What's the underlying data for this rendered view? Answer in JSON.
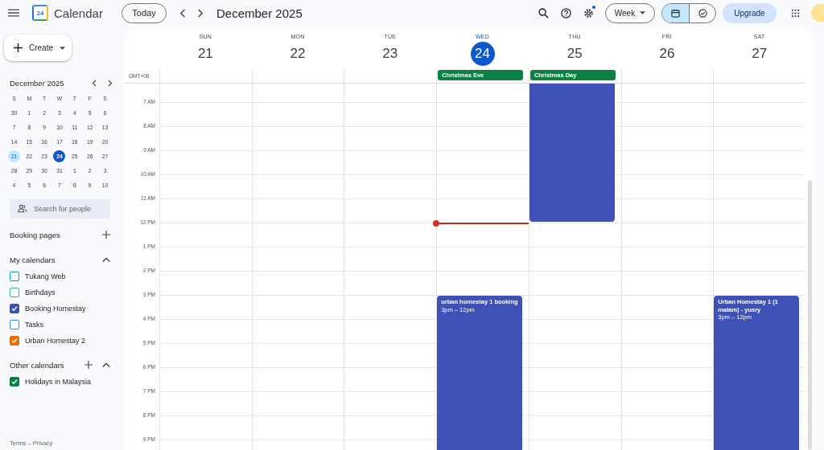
{
  "app": {
    "title": "Calendar",
    "logo_text": "24"
  },
  "toolbar": {
    "today": "Today",
    "period": "December 2025",
    "view": "Week",
    "modes": [
      {
        "kind": "calendar",
        "selected": true
      },
      {
        "kind": "tasks",
        "selected": false
      }
    ],
    "upgrade": "Upgrade",
    "settings_badge": true
  },
  "sidebar": {
    "create": "Create",
    "mini_calendar": {
      "title": "December 2025",
      "weekdays": [
        "S",
        "M",
        "T",
        "W",
        "T",
        "F",
        "S"
      ],
      "weeks": [
        [
          {
            "d": "30",
            "selected": false,
            "today": false
          },
          {
            "d": "1",
            "selected": false,
            "today": false
          },
          {
            "d": "2",
            "selected": false,
            "today": false
          },
          {
            "d": "3",
            "selected": false,
            "today": false
          },
          {
            "d": "4",
            "selected": false,
            "today": false
          },
          {
            "d": "5",
            "selected": false,
            "today": false
          },
          {
            "d": "6",
            "selected": false,
            "today": false
          }
        ],
        [
          {
            "d": "7",
            "selected": false,
            "today": false
          },
          {
            "d": "8",
            "selected": false,
            "today": false
          },
          {
            "d": "9",
            "selected": false,
            "today": false
          },
          {
            "d": "10",
            "selected": false,
            "today": false
          },
          {
            "d": "11",
            "selected": false,
            "today": false
          },
          {
            "d": "12",
            "selected": false,
            "today": false
          },
          {
            "d": "13",
            "selected": false,
            "today": false
          }
        ],
        [
          {
            "d": "14",
            "selected": false,
            "today": false
          },
          {
            "d": "15",
            "selected": false,
            "today": false
          },
          {
            "d": "16",
            "selected": false,
            "today": false
          },
          {
            "d": "17",
            "selected": false,
            "today": false
          },
          {
            "d": "18",
            "selected": false,
            "today": false
          },
          {
            "d": "19",
            "selected": false,
            "today": false
          },
          {
            "d": "20",
            "selected": false,
            "today": false
          }
        ],
        [
          {
            "d": "21",
            "selected": true,
            "today": false
          },
          {
            "d": "22",
            "selected": false,
            "today": false
          },
          {
            "d": "23",
            "selected": false,
            "today": false
          },
          {
            "d": "24",
            "selected": false,
            "today": true
          },
          {
            "d": "25",
            "selected": false,
            "today": false
          },
          {
            "d": "26",
            "selected": false,
            "today": false
          },
          {
            "d": "27",
            "selected": false,
            "today": false
          }
        ],
        [
          {
            "d": "28",
            "selected": false,
            "today": false
          },
          {
            "d": "29",
            "selected": false,
            "today": false
          },
          {
            "d": "30",
            "selected": false,
            "today": false
          },
          {
            "d": "31",
            "selected": false,
            "today": false
          },
          {
            "d": "1",
            "selected": false,
            "today": false
          },
          {
            "d": "2",
            "selected": false,
            "today": false
          },
          {
            "d": "3",
            "selected": false,
            "today": false
          }
        ],
        [
          {
            "d": "4",
            "selected": false,
            "today": false
          },
          {
            "d": "5",
            "selected": false,
            "today": false
          },
          {
            "d": "6",
            "selected": false,
            "today": false
          },
          {
            "d": "7",
            "selected": false,
            "today": false
          },
          {
            "d": "8",
            "selected": false,
            "today": false
          },
          {
            "d": "9",
            "selected": false,
            "today": false
          },
          {
            "d": "10",
            "selected": false,
            "today": false
          }
        ]
      ]
    },
    "search": {
      "placeholder": "Search for people"
    },
    "booking_pages": "Booking pages",
    "my_calendars": {
      "title": "My calendars",
      "expanded": true,
      "items": [
        {
          "name": "Tukang Web",
          "checked": false,
          "color": "#039be5"
        },
        {
          "name": "Birthdays",
          "checked": false,
          "color": "#33b679"
        },
        {
          "name": "Booking Homestay",
          "checked": true,
          "color": "#3f51b5"
        },
        {
          "name": "Tasks",
          "checked": false,
          "color": "#4285f4"
        },
        {
          "name": "Urban Homestay 2",
          "checked": true,
          "color": "#ef6c00"
        }
      ]
    },
    "other_calendars": {
      "title": "Other calendars",
      "expanded": true,
      "items": [
        {
          "name": "Holidays in Malaysia",
          "checked": true,
          "color": "#0b8043"
        }
      ]
    },
    "footer": "Terms – Privacy"
  },
  "week": {
    "timezone": "GMT+08",
    "days": [
      {
        "name": "SUN",
        "date": "21",
        "today": false
      },
      {
        "name": "MON",
        "date": "22",
        "today": false
      },
      {
        "name": "TUE",
        "date": "23",
        "today": false
      },
      {
        "name": "WED",
        "date": "24",
        "today": true,
        "all_day": [
          {
            "title": "Christmas Eve"
          }
        ],
        "event": {
          "title": "urban homestay 1 booking",
          "time": "3pm – 12pm"
        },
        "busy": [
          false,
          false,
          false,
          false,
          false,
          false,
          false,
          false,
          false,
          true,
          true,
          true,
          true,
          true,
          true,
          true
        ]
      },
      {
        "name": "THU",
        "date": "25",
        "today": false,
        "all_day": [
          {
            "title": "Christmas Day"
          }
        ],
        "busy": [
          true,
          true,
          true,
          true,
          true,
          true,
          false,
          false,
          false,
          false,
          false,
          false,
          false,
          false,
          false,
          false
        ]
      },
      {
        "name": "FRI",
        "date": "26",
        "today": false
      },
      {
        "name": "SAT",
        "date": "27",
        "today": false,
        "event": {
          "title": "Urban Homestay 1 (1 malam) - yusry",
          "time": "3pm – 12pm"
        },
        "busy": [
          false,
          false,
          false,
          false,
          false,
          false,
          false,
          false,
          false,
          true,
          true,
          true,
          true,
          true,
          true,
          true
        ]
      }
    ],
    "hours": [
      {
        "label": "7 AM",
        "now": false
      },
      {
        "label": "8 AM",
        "now": false
      },
      {
        "label": "9 AM",
        "now": false
      },
      {
        "label": "10 AM",
        "now": false
      },
      {
        "label": "11 AM",
        "now": false
      },
      {
        "label": "12 PM",
        "now": true
      },
      {
        "label": "1 PM",
        "now": false
      },
      {
        "label": "2 PM",
        "now": false
      },
      {
        "label": "3 PM",
        "now": false
      },
      {
        "label": "4 PM",
        "now": false
      },
      {
        "label": "5 PM",
        "now": false
      },
      {
        "label": "6 PM",
        "now": false
      },
      {
        "label": "7 PM",
        "now": false
      },
      {
        "label": "8 PM",
        "now": false
      },
      {
        "label": "9 PM",
        "now": false
      }
    ]
  }
}
